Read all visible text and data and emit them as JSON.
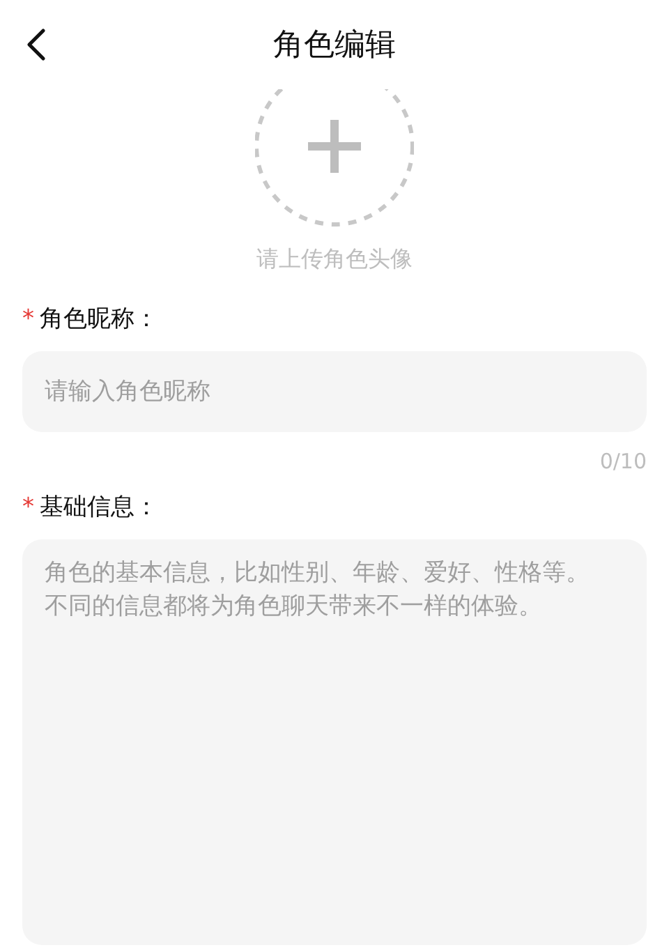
{
  "header": {
    "title": "角色编辑"
  },
  "avatar_upload": {
    "caption": "请上传角色头像"
  },
  "fields": [
    {
      "kind": "input",
      "required_mark": "*",
      "label": "角色昵称：",
      "placeholder": "请输入角色昵称",
      "counter": "0/10"
    },
    {
      "kind": "textarea",
      "required_mark": "*",
      "label": "基础信息：",
      "placeholder": "角色的基本信息，比如性别、年龄、爱好、性格等。不同的信息都将为角色聊天带来不一样的体验。"
    }
  ]
}
